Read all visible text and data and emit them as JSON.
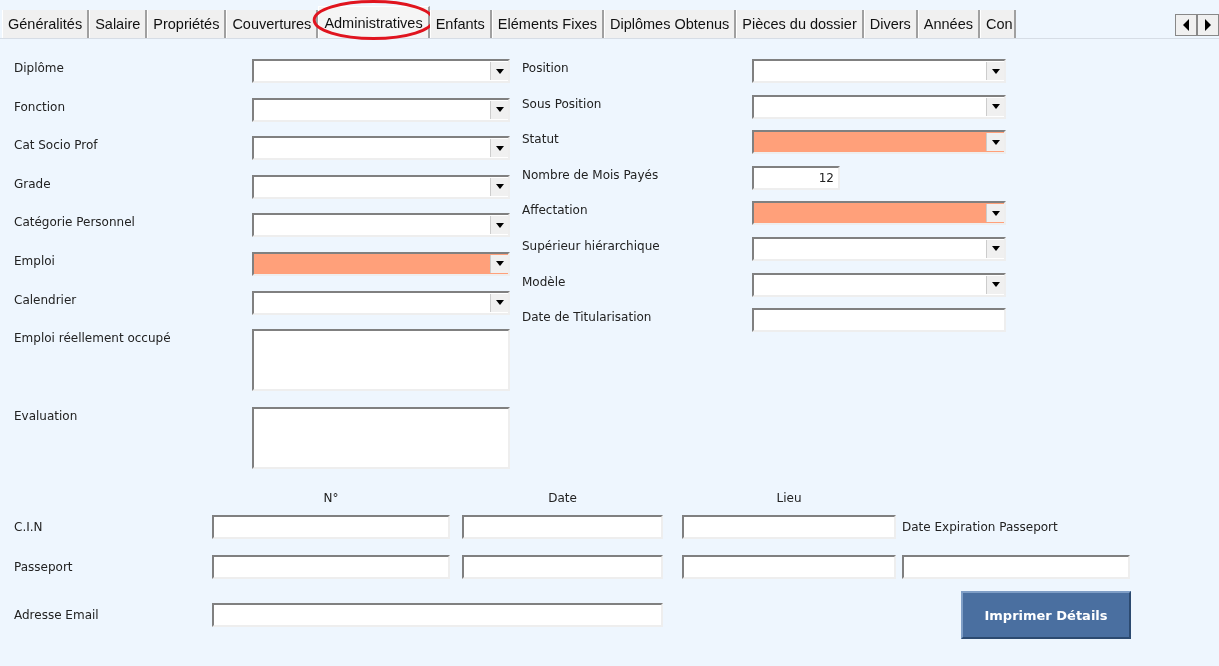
{
  "tabs": [
    {
      "label": "Généralités",
      "selected": false
    },
    {
      "label": "Salaire",
      "selected": false
    },
    {
      "label": "Propriétés",
      "selected": false
    },
    {
      "label": "Couvertures",
      "selected": false
    },
    {
      "label": "Administratives",
      "selected": true,
      "circled": true
    },
    {
      "label": "Enfants",
      "selected": false
    },
    {
      "label": "Eléments Fixes",
      "selected": false
    },
    {
      "label": "Diplômes Obtenus",
      "selected": false
    },
    {
      "label": "Pièces du dossier",
      "selected": false
    },
    {
      "label": "Divers",
      "selected": false
    },
    {
      "label": "Années",
      "selected": false
    },
    {
      "label": "Con",
      "selected": false
    }
  ],
  "left_fields": [
    {
      "label": "Diplôme",
      "kind": "combo",
      "required": false
    },
    {
      "label": "Fonction",
      "kind": "combo",
      "required": false
    },
    {
      "label": "Cat Socio Prof",
      "kind": "combo",
      "required": false
    },
    {
      "label": "Grade",
      "kind": "combo",
      "required": false
    },
    {
      "label": "Catégorie Personnel",
      "kind": "combo",
      "required": false
    },
    {
      "label": "Emploi",
      "kind": "combo",
      "required": true
    },
    {
      "label": "Calendrier",
      "kind": "combo",
      "required": false
    },
    {
      "label": "Emploi réellement occupé",
      "kind": "memo",
      "required": false
    },
    {
      "label": "Evaluation",
      "kind": "memo",
      "required": false
    }
  ],
  "right_fields": [
    {
      "label": "Position",
      "kind": "combo",
      "required": false
    },
    {
      "label": "Sous Position",
      "kind": "combo",
      "required": false
    },
    {
      "label": "Statut",
      "kind": "combo",
      "required": true
    },
    {
      "label": "Nombre de Mois Payés",
      "kind": "number",
      "required": false,
      "value": "12"
    },
    {
      "label": "Affectation",
      "kind": "combo",
      "required": true
    },
    {
      "label": "Supérieur hiérarchique",
      "kind": "combo",
      "required": false
    },
    {
      "label": "Modèle",
      "kind": "combo",
      "required": false
    },
    {
      "label": "Date de Titularisation",
      "kind": "text",
      "required": false
    }
  ],
  "identity": {
    "headers": [
      "N°",
      "Date",
      "Lieu"
    ],
    "extra_header": "Date Expiration Passeport",
    "rows": [
      {
        "label": "C.I.N"
      },
      {
        "label": "Passeport"
      }
    ]
  },
  "email": {
    "label": "Adresse Email"
  },
  "print_button": "Imprimer Détails"
}
